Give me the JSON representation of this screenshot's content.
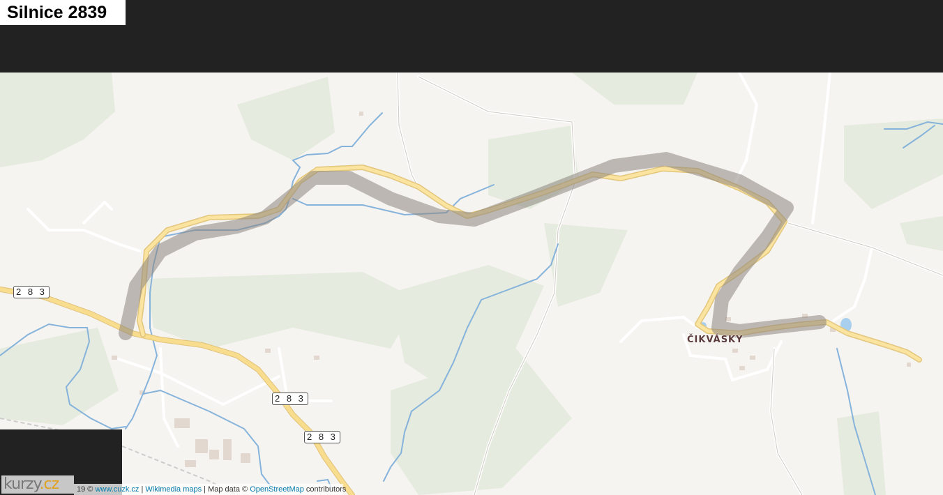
{
  "page": {
    "title": "Silnice 2839"
  },
  "map": {
    "place_label": "ČIKVÁSKY",
    "road_shields": [
      "2 8 3",
      "2 8 3",
      "2 8 3"
    ],
    "logo": {
      "text_main": "kurzy",
      "text_accent": ".cz"
    },
    "attribution": {
      "prefix": "19 ©",
      "link1": "www.cuzk.cz",
      "sep1": "|",
      "link2": "Wikimedia maps",
      "middle": "| Map data ©",
      "link3": "OpenStreetMap",
      "suffix": "contributors"
    },
    "colors": {
      "background": "#f6f4f0",
      "forest": "#e6ece0",
      "water": "#7fb0d8",
      "main_road": "#f7dc8c",
      "highlight_route": "#8c8580"
    }
  }
}
